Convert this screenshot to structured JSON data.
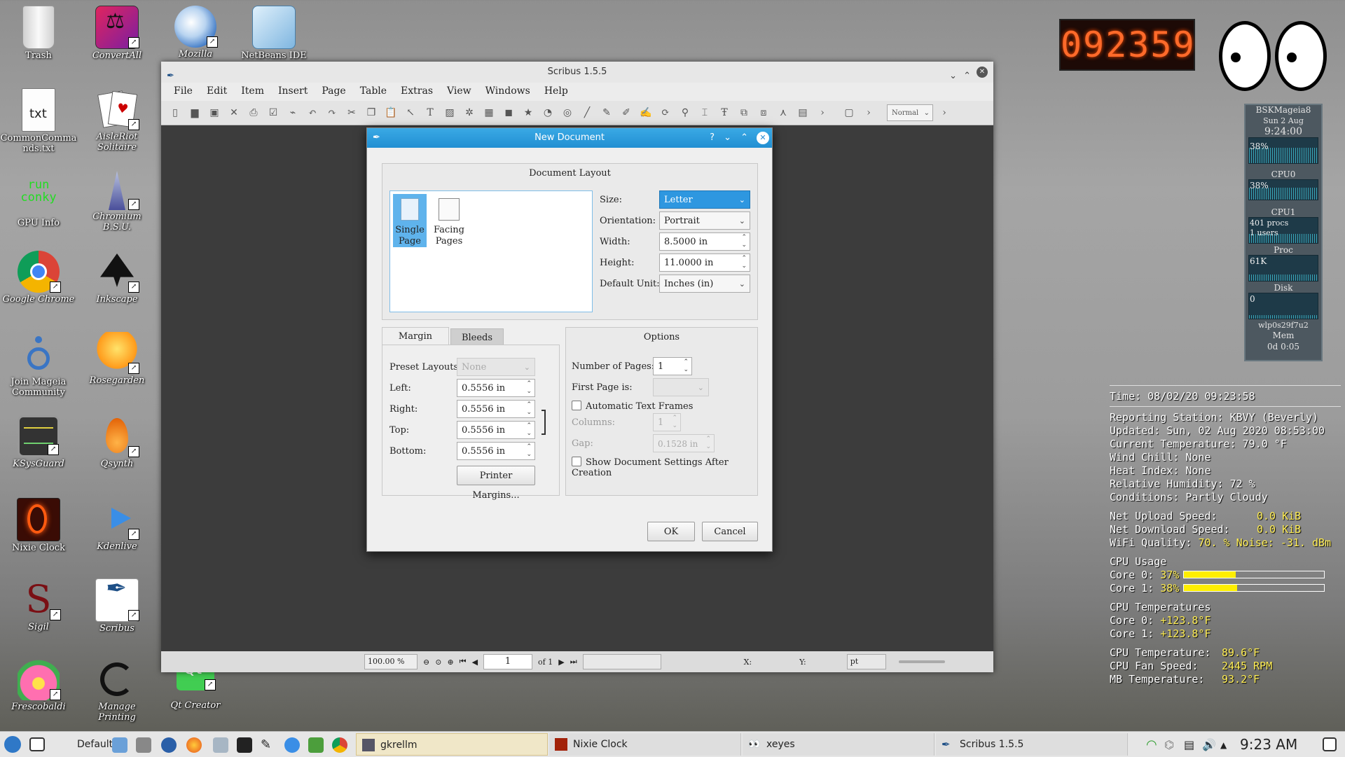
{
  "desktop_icons": [
    {
      "label": "Trash"
    },
    {
      "label": "ConvertAll"
    },
    {
      "label": "Mozilla"
    },
    {
      "label": "NetBeans IDE"
    },
    {
      "label": "CommonCommands.txt"
    },
    {
      "label": "AisleRiot Solitaire"
    },
    {
      "label": "GPU Info"
    },
    {
      "label": "Chromium B.S.U."
    },
    {
      "label": "Google Chrome"
    },
    {
      "label": "Inkscape"
    },
    {
      "label": "Join Mageia Community"
    },
    {
      "label": "Rosegarden"
    },
    {
      "label": "KSysGuard"
    },
    {
      "label": "Qsynth"
    },
    {
      "label": "Nixie Clock"
    },
    {
      "label": "Kdenlive"
    },
    {
      "label": "Sigil"
    },
    {
      "label": "Scribus"
    },
    {
      "label": "Frescobaldi"
    },
    {
      "label": "Manage Printing"
    },
    {
      "label": "Qt Creator"
    }
  ],
  "conky_icon_text": {
    "line1": "run",
    "line2": "conky"
  },
  "main_window": {
    "title": "Scribus 1.5.5",
    "menu": [
      "File",
      "Edit",
      "Item",
      "Insert",
      "Page",
      "Table",
      "Extras",
      "View",
      "Windows",
      "Help"
    ],
    "toolbar_mode": "Normal",
    "status": {
      "zoom": "100.00 %",
      "page": "1",
      "of_pages": "of 1",
      "x_label": "X:",
      "y_label": "Y:",
      "unit": "pt"
    }
  },
  "dialog": {
    "title": "New Document",
    "title_buttons": {
      "help": "?",
      "close": "✕"
    },
    "layout_group_title": "Document Layout",
    "layouts": [
      {
        "label_1": "Single",
        "label_2": "Page",
        "selected": true
      },
      {
        "label_1": "Facing",
        "label_2": "Pages",
        "selected": false
      }
    ],
    "size": {
      "label": "Size:",
      "value": "Letter"
    },
    "orientation": {
      "label": "Orientation:",
      "value": "Portrait"
    },
    "width": {
      "label": "Width:",
      "value": "8.5000 in"
    },
    "height": {
      "label": "Height:",
      "value": "11.0000 in"
    },
    "default_unit": {
      "label": "Default Unit:",
      "value": "Inches (in)"
    },
    "tabs": [
      {
        "label": "Margin Guides",
        "active": true
      },
      {
        "label": "Bleeds",
        "active": false
      }
    ],
    "margins": {
      "preset": {
        "label": "Preset Layouts:",
        "value": "None"
      },
      "left": {
        "label": "Left:",
        "value": "0.5556 in"
      },
      "right": {
        "label": "Right:",
        "value": "0.5556 in"
      },
      "top": {
        "label": "Top:",
        "value": "0.5556 in"
      },
      "bottom": {
        "label": "Bottom:",
        "value": "0.5556 in"
      },
      "printer_button": "Printer Margins..."
    },
    "options": {
      "title": "Options",
      "num_pages": {
        "label": "Number of Pages:",
        "value": "1"
      },
      "first_page": {
        "label": "First Page is:",
        "value": ""
      },
      "auto_text_frames": {
        "label": "Automatic Text Frames",
        "checked": false
      },
      "columns": {
        "label": "Columns:",
        "value": "1"
      },
      "gap": {
        "label": "Gap:",
        "value": "0.1528 in"
      },
      "show_settings": {
        "label": "Show Document Settings After Creation",
        "checked": false
      }
    },
    "ok_label": "OK",
    "cancel_label": "Cancel"
  },
  "nixie": {
    "time": "092359"
  },
  "gkrellm": {
    "host": "BSKMageia8",
    "date": "Sun 2 Aug",
    "time": "9:24:00",
    "cpu_total": "38%",
    "cpu0_label": "CPU0",
    "cpu0": "38%",
    "cpu1_label": "CPU1",
    "procs": "401 procs",
    "users": "1 users",
    "proc_label": "Proc",
    "proc_val": "61K",
    "disk_label": "Disk",
    "disk_val": "0",
    "net_if": "wlp0s29f7u2",
    "mem_label": "Mem",
    "uptime": "0d 0:05"
  },
  "conky": {
    "time_line": "Time:  08/02/20 09:23:58",
    "weather": [
      "Reporting Station: KBVY (Beverly)",
      "Updated: Sun, 02 Aug 2020 08:53:00",
      "Current Temperature: 79.0 °F",
      "Wind Chill: None",
      "Heat Index: None",
      "Relative Humidity: 72 %",
      "Conditions: Partly Cloudy"
    ],
    "net": {
      "up_label": "Net Upload Speed:",
      "up": "0.0 KiB",
      "down_label": "Net Download Speed:",
      "down": "0.0 KiB",
      "wifi_label": "WiFi Quality:",
      "wifi": "70. % Noise: -31. dBm"
    },
    "cpu_usage_title": "CPU Usage",
    "cores": [
      {
        "label": "Core 0:",
        "value": "37%",
        "percent": 37
      },
      {
        "label": "Core 1:",
        "value": "38%",
        "percent": 38
      }
    ],
    "cpu_temps_title": "CPU Temperatures",
    "core_temps": [
      {
        "label": "Core 0:",
        "value": "+123.8°F"
      },
      {
        "label": "Core 1:",
        "value": "+123.8°F"
      }
    ],
    "sensors": [
      {
        "label": "CPU Temperature:",
        "value": "89.6°F"
      },
      {
        "label": "CPU Fan Speed:",
        "value": "2445 RPM"
      },
      {
        "label": "MB Temperature:",
        "value": "93.2°F"
      }
    ]
  },
  "taskbar": {
    "desktop_name": "Default",
    "tasks": [
      {
        "label": "gkrellm",
        "active": true
      },
      {
        "label": "Nixie Clock",
        "active": false
      },
      {
        "label": "xeyes",
        "active": false
      },
      {
        "label": "Scribus 1.5.5",
        "active": false
      }
    ],
    "clock": "9:23 AM"
  }
}
